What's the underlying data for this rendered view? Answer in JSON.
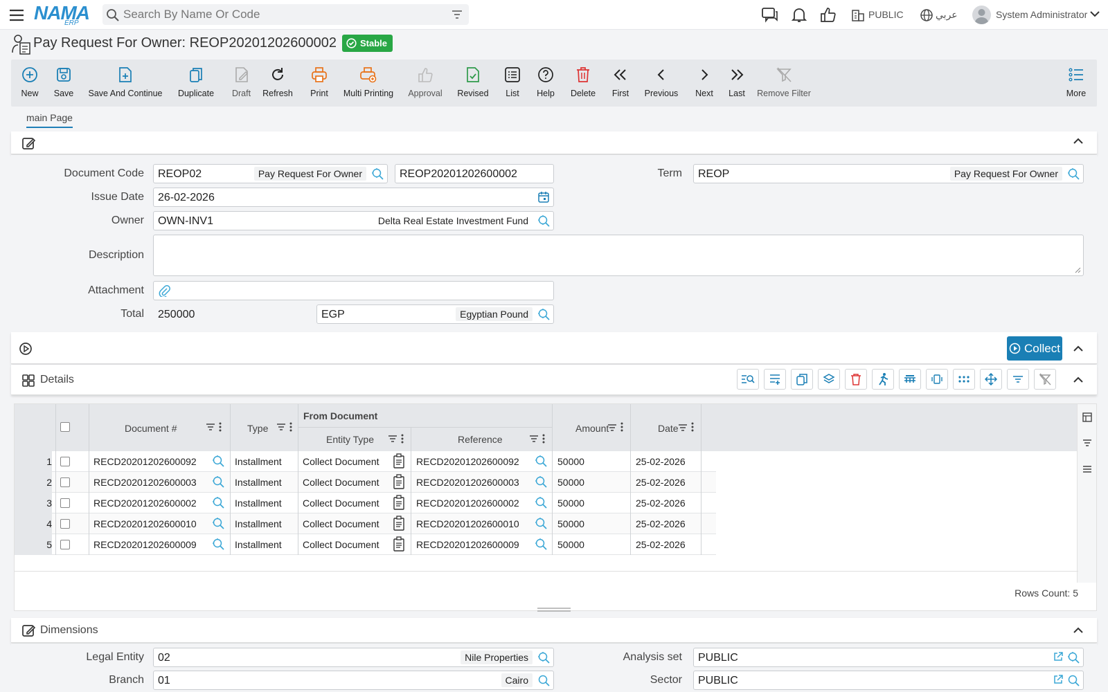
{
  "app": {
    "logo": "NAMA",
    "logo_sub": "ERP"
  },
  "header": {
    "search_placeholder": "Search By Name Or Code",
    "company": "PUBLIC",
    "language": "عربي",
    "user": "System Administrator"
  },
  "page": {
    "title": "Pay Request For Owner: REOP20201202600002",
    "status": "Stable"
  },
  "toolbar": {
    "new": "New",
    "save": "Save",
    "save_continue": "Save And Continue",
    "duplicate": "Duplicate",
    "draft": "Draft",
    "refresh": "Refresh",
    "print": "Print",
    "multi_printing": "Multi Printing",
    "approval": "Approval",
    "revised": "Revised",
    "list": "List",
    "help": "Help",
    "delete": "Delete",
    "first": "First",
    "previous": "Previous",
    "next": "Next",
    "last": "Last",
    "remove_filter": "Remove Filter",
    "more": "More"
  },
  "tabs": {
    "main": "main Page"
  },
  "form": {
    "document_code_label": "Document Code",
    "document_code": "REOP02",
    "document_code_name": "Pay Request For Owner",
    "document_number": "REOP20201202600002",
    "term_label": "Term",
    "term": "REOP",
    "term_name": "Pay Request For Owner",
    "issue_date_label": "Issue Date",
    "issue_date": "26-02-2026",
    "owner_label": "Owner",
    "owner": "OWN-INV1",
    "owner_name": "Delta Real Estate Investment Fund",
    "description_label": "Description",
    "attachment_label": "Attachment",
    "total_label": "Total",
    "total": "250000",
    "currency": "EGP",
    "currency_name": "Egyptian Pound"
  },
  "actions": {
    "collect": "Collect"
  },
  "details": {
    "title": "Details",
    "columns": {
      "document": "Document #",
      "type": "Type",
      "from_document": "From Document",
      "entity_type": "Entity Type",
      "reference": "Reference",
      "amount": "Amount",
      "date": "Date"
    },
    "rows": [
      {
        "n": "1",
        "doc": "RECD20201202600092",
        "type": "Installment",
        "entity": "Collect Document",
        "ref": "RECD20201202600092",
        "amount": "50000",
        "date": "25-02-2026"
      },
      {
        "n": "2",
        "doc": "RECD20201202600003",
        "type": "Installment",
        "entity": "Collect Document",
        "ref": "RECD20201202600003",
        "amount": "50000",
        "date": "25-02-2026"
      },
      {
        "n": "3",
        "doc": "RECD20201202600002",
        "type": "Installment",
        "entity": "Collect Document",
        "ref": "RECD20201202600002",
        "amount": "50000",
        "date": "25-02-2026"
      },
      {
        "n": "4",
        "doc": "RECD20201202600010",
        "type": "Installment",
        "entity": "Collect Document",
        "ref": "RECD20201202600010",
        "amount": "50000",
        "date": "25-02-2026"
      },
      {
        "n": "5",
        "doc": "RECD20201202600009",
        "type": "Installment",
        "entity": "Collect Document",
        "ref": "RECD20201202600009",
        "amount": "50000",
        "date": "25-02-2026"
      }
    ],
    "rows_count": "Rows Count: 5"
  },
  "dimensions": {
    "title": "Dimensions",
    "legal_entity_label": "Legal Entity",
    "legal_entity": "02",
    "legal_entity_name": "Nile Properties",
    "analysis_set_label": "Analysis set",
    "analysis_set": "PUBLIC",
    "branch_label": "Branch",
    "branch": "01",
    "branch_name": "Cairo",
    "sector_label": "Sector",
    "sector": "PUBLIC"
  },
  "colors": {
    "accent": "#1a7fb5",
    "stable": "#28a745",
    "delete": "#d33",
    "print": "#e8731a",
    "logo": "#2b8fcf"
  }
}
